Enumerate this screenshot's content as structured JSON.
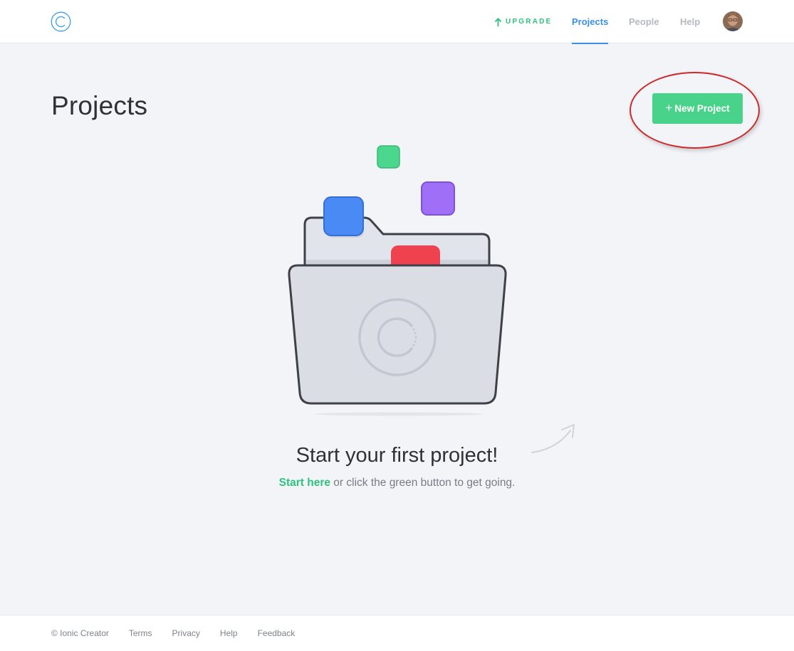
{
  "header": {
    "logo_icon": "ionic-creator-logo-icon",
    "upgrade_label": "UPGRADE",
    "upgrade_icon": "arrow-up-icon",
    "nav": [
      {
        "label": "Projects",
        "active": true
      },
      {
        "label": "People",
        "active": false
      },
      {
        "label": "Help",
        "active": false
      }
    ],
    "avatar_icon": "user-avatar"
  },
  "main": {
    "title": "Projects",
    "new_project_button": {
      "icon": "plus-icon",
      "plus": "+",
      "label": "New Project"
    },
    "empty_state": {
      "illustration": "folder-with-app-tiles-illustration",
      "title": "Start your first project!",
      "link_label": "Start here",
      "sub_text": " or click the green button to get going."
    }
  },
  "footer": {
    "copyright": "© Ionic Creator",
    "links": [
      "Terms",
      "Privacy",
      "Help",
      "Feedback"
    ]
  },
  "colors": {
    "accent_green": "#49d38a",
    "accent_blue": "#3a8ee6",
    "annotation_red": "#cc2a2a",
    "tile_green": "#4cd78e",
    "tile_blue": "#4a8af4",
    "tile_purple": "#9f6ff8",
    "tile_red": "#f0414e"
  }
}
